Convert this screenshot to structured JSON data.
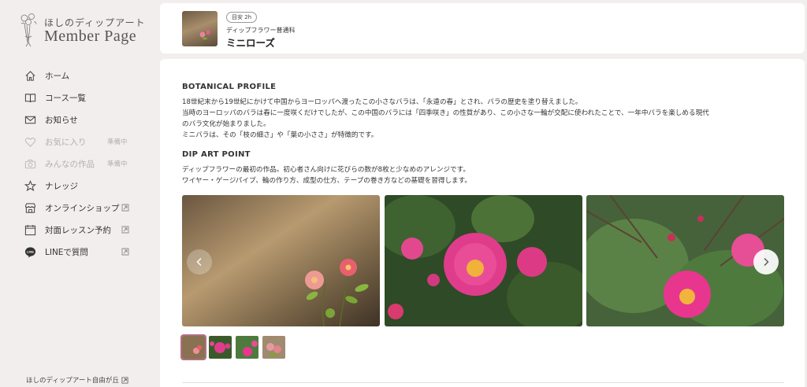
{
  "brand": {
    "small": "ほしのディップアート",
    "title": "Member Page"
  },
  "nav": [
    {
      "label": "ホーム",
      "icon": "home-icon",
      "tag": "",
      "external": false,
      "disabled": false
    },
    {
      "label": "コース一覧",
      "icon": "book-icon",
      "tag": "",
      "external": false,
      "disabled": false
    },
    {
      "label": "お知らせ",
      "icon": "mail-icon",
      "tag": "",
      "external": false,
      "disabled": false
    },
    {
      "label": "お気に入り",
      "icon": "heart-icon",
      "tag": "準備中",
      "external": false,
      "disabled": true
    },
    {
      "label": "みんなの作品",
      "icon": "camera-icon",
      "tag": "準備中",
      "external": false,
      "disabled": true
    },
    {
      "label": "ナレッジ",
      "icon": "star-icon",
      "tag": "",
      "external": false,
      "disabled": false
    },
    {
      "label": "オンラインショップ",
      "icon": "shop-icon",
      "tag": "",
      "external": true,
      "disabled": false
    },
    {
      "label": "対面レッスン予約",
      "icon": "calendar-icon",
      "tag": "",
      "external": true,
      "disabled": false
    },
    {
      "label": "LINEで質問",
      "icon": "line-icon",
      "tag": "",
      "external": true,
      "disabled": false
    }
  ],
  "footer": {
    "label": "ほしのディップアート自由が丘"
  },
  "course": {
    "badge": "目安 2h",
    "category": "ディップフラワー普通科",
    "name": "ミニローズ"
  },
  "botanical": {
    "title": "BOTANICAL PROFILE",
    "lines": [
      "18世紀末から19世紀にかけて中国からヨーロッパへ渡ったこの小さなバラは、「永遠の春」とされ、バラの歴史を塗り替えました。",
      "当時のヨーロッパのバラは春に一度咲くだけでしたが、この中国のバラには「四季咲き」の性質があり、この小さな一輪が交配に使われたことで、一年中バラを楽しめる現代",
      "のバラ文化が始まりました。",
      "ミニバラは、その「枝の細さ」や「葉の小ささ」が特徴的です。"
    ]
  },
  "dipart": {
    "title": "DIP ART POINT",
    "lines": [
      "ディップフラワーの最初の作品。初心者さん向けに花びらの数が8枚と少なめのアレンジです。",
      "ワイヤー・ゲージパイプ、輪の作り方、成型の仕方、テープの巻き方などの基礎を習得します。"
    ]
  },
  "colors": {
    "accent": "#b06f83",
    "background": "#f3eeee",
    "card": "#ffffff"
  }
}
